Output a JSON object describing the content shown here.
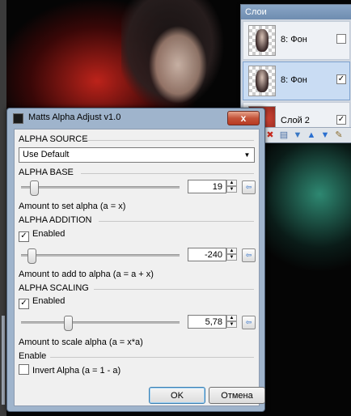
{
  "layers_panel": {
    "title": "Слои",
    "layers": [
      {
        "name": "8: Фон",
        "visible": false,
        "selected": false
      },
      {
        "name": "8: Фон",
        "visible": true,
        "selected": true
      },
      {
        "name": "Слой 2",
        "visible": true,
        "selected": false
      }
    ]
  },
  "dialog": {
    "title": "Matts Alpha Adjust v1.0",
    "close_glyph": "x",
    "alpha_source": {
      "heading": "ALPHA SOURCE",
      "selected": "Use Default"
    },
    "alpha_base": {
      "heading": "ALPHA BASE",
      "value": "19",
      "slider_fraction": 0.075,
      "description": "Amount to set alpha (a = x)"
    },
    "alpha_addition": {
      "heading": "ALPHA ADDITION",
      "enabled_label": "Enabled",
      "enabled": true,
      "value": "-240",
      "slider_fraction": 0.06,
      "description": "Amount to add to alpha (a = a + x)"
    },
    "alpha_scaling": {
      "heading": "ALPHA SCALING",
      "enabled_label": "Enabled",
      "enabled": true,
      "value": "5,78",
      "slider_fraction": 0.29,
      "description": "Amount to scale alpha (a = x*a)"
    },
    "enable": {
      "heading": "Enable",
      "invert_label": "Invert Alpha (a = 1 - a)",
      "invert": false
    },
    "ok_label": "OK",
    "cancel_label": "Отмена"
  }
}
